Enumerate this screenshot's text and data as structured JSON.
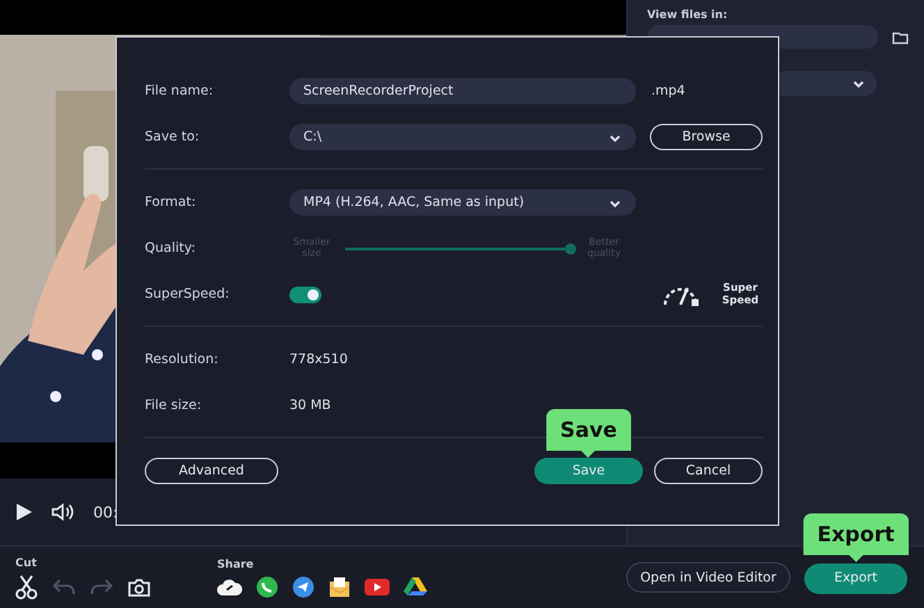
{
  "player": {
    "time": "00:"
  },
  "export_panel": {
    "view_files_label": "View files in:"
  },
  "dialog": {
    "file_name": {
      "label": "File name:",
      "value": "ScreenRecorderProject",
      "extension": ".mp4"
    },
    "save_to": {
      "label": "Save to:",
      "value": "C:\\",
      "button": "Browse"
    },
    "format": {
      "label": "Format:",
      "value": "MP4 (H.264, AAC, Same as input)"
    },
    "quality": {
      "label": "Quality:",
      "min_label": "Smaller size",
      "max_label": "Better quality",
      "level": 1
    },
    "superspeed": {
      "label": "SuperSpeed:",
      "on": true,
      "badge": "Super Speed"
    },
    "resolution": {
      "label": "Resolution:",
      "value": "778x510"
    },
    "file_size": {
      "label": "File size:",
      "value": "30 MB"
    },
    "buttons": [
      {
        "label": "Advanced",
        "kind": "outline"
      },
      {
        "label": "Save",
        "kind": "primary",
        "callout": "Save"
      },
      {
        "label": "Cancel",
        "kind": "outline"
      }
    ]
  },
  "toolbar": {
    "cut_label": "Cut",
    "share_label": "Share",
    "tools": [
      {
        "kind": "cut",
        "disabled": false
      },
      {
        "kind": "undo",
        "disabled": true
      },
      {
        "kind": "redo",
        "disabled": true
      },
      {
        "kind": "snapshot",
        "disabled": false
      }
    ],
    "open_editor": "Open in Video Editor",
    "export": "Export",
    "export_callout": "Export"
  }
}
